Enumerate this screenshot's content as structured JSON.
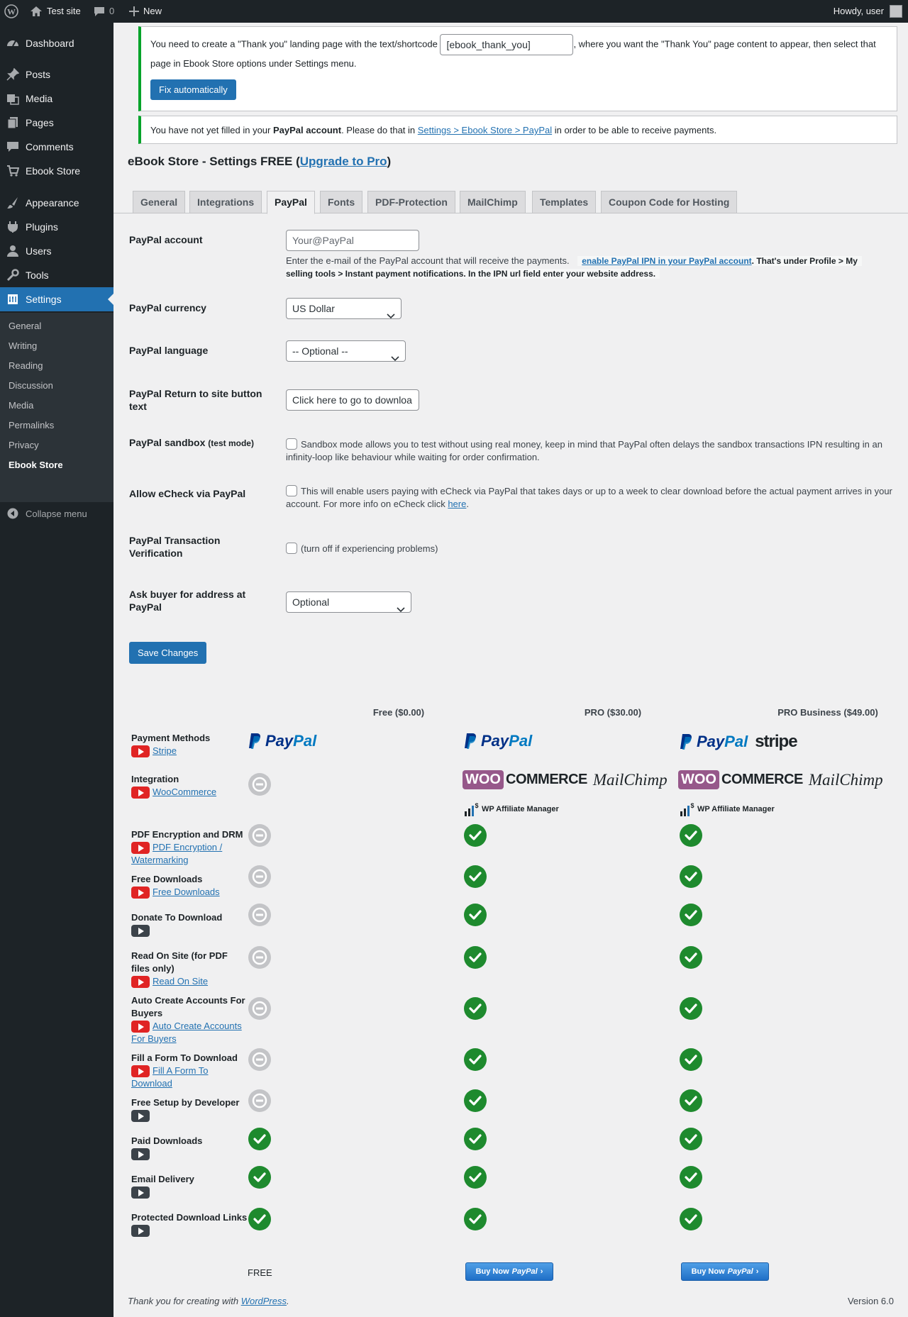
{
  "admin_bar": {
    "site_name": "Test site",
    "comments_count": "0",
    "new_label": "New",
    "howdy": "Howdy, user"
  },
  "sidebar": {
    "items": [
      {
        "label": "Dashboard",
        "icon": "dashboard-icon"
      },
      {
        "label": "Posts",
        "icon": "pin-icon"
      },
      {
        "label": "Media",
        "icon": "media-icon"
      },
      {
        "label": "Pages",
        "icon": "pages-icon"
      },
      {
        "label": "Comments",
        "icon": "comment-icon"
      },
      {
        "label": "Ebook Store",
        "icon": "cart-icon"
      },
      {
        "label": "Appearance",
        "icon": "brush-icon"
      },
      {
        "label": "Plugins",
        "icon": "plug-icon"
      },
      {
        "label": "Users",
        "icon": "user-icon"
      },
      {
        "label": "Tools",
        "icon": "wrench-icon"
      },
      {
        "label": "Settings",
        "icon": "settings-icon"
      }
    ],
    "submenu": [
      "General",
      "Writing",
      "Reading",
      "Discussion",
      "Media",
      "Permalinks",
      "Privacy",
      "Ebook Store"
    ],
    "collapse_label": "Collapse menu"
  },
  "notices": {
    "thank_you_pre": "You need to create a \"Thank you\" landing page with the text/shortcode",
    "thank_you_shortcode": "[ebook_thank_you]",
    "thank_you_post": ", where you want the \"Thank You\" page content to appear, then select that page in Ebook Store options under Settings menu.",
    "fix_button": "Fix automatically",
    "paypal_pre": "You have not yet filled in your ",
    "paypal_bold": "PayPal account",
    "paypal_mid": ". Please do that in ",
    "paypal_link": "Settings > Ebook Store > PayPal",
    "paypal_post": " in order to be able to receive payments."
  },
  "page": {
    "title_pre": "eBook Store - Settings FREE (",
    "title_link": "Upgrade to Pro",
    "title_post": ")"
  },
  "tabs": [
    "General",
    "Integrations",
    "PayPal",
    "Fonts",
    "PDF-Protection",
    "MailChimp",
    "Templates",
    "Coupon Code for Hosting"
  ],
  "form": {
    "paypal_account_label": "PayPal account",
    "paypal_account_placeholder": "Your@PayPal",
    "paypal_account_desc": "Enter the e-mail of the PayPal account that will receive the payments.",
    "ipn_link": "enable PayPal IPN in your PayPal account",
    "ipn_text_1": ". That's under Profile > My",
    "ipn_text_2": "selling tools > Instant payment notifications. In the IPN url field enter your website address.",
    "currency_label": "PayPal currency",
    "currency_value": "US Dollar",
    "language_label": "PayPal language",
    "language_value": "-- Optional --",
    "return_label": "PayPal Return to site button text",
    "return_value": "Click here to go to downloa",
    "sandbox_label": "PayPal sandbox",
    "sandbox_small": "(test mode)",
    "sandbox_desc": "Sandbox mode allows you to test without using real money, keep in mind that PayPal often delays the sandbox transactions IPN resulting in an infinity-loop like behaviour while waiting for order confirmation.",
    "echeck_label": "Allow eCheck via PayPal",
    "echeck_desc": "This will enable users paying with eCheck via PayPal that takes days or up to a week to clear download before the actual payment arrives in your account. For more info on eCheck click ",
    "echeck_link": "here",
    "verify_label": "PayPal Transaction Verification",
    "verify_desc": "(turn off if experiencing problems)",
    "address_label": "Ask buyer for address at PayPal",
    "address_value": "Optional",
    "save_button": "Save Changes"
  },
  "comparison": {
    "columns": [
      "Free ($0.00)",
      "PRO ($30.00)",
      "PRO Business ($49.00)"
    ],
    "features": [
      {
        "name": "Payment Methods",
        "link": "Stripe"
      },
      {
        "name": "Integration",
        "link": "WooCommerce"
      },
      {
        "name": "PDF Encryption and DRM",
        "link": "PDF Encryption / Watermarking"
      },
      {
        "name": "Free Downloads",
        "link": "Free Downloads"
      },
      {
        "name": "Donate To Download",
        "link": ""
      },
      {
        "name": "Read On Site (for PDF files only)",
        "link": "Read On Site"
      },
      {
        "name": "Auto Create Accounts For Buyers",
        "link": "Auto Create Accounts For Buyers"
      },
      {
        "name": "Fill a Form To Download",
        "link": "Fill A Form To Download"
      },
      {
        "name": "Free Setup by Developer",
        "link": ""
      },
      {
        "name": "Paid Downloads",
        "link": ""
      },
      {
        "name": "Email Delivery",
        "link": ""
      },
      {
        "name": "Protected Download Links",
        "link": ""
      }
    ],
    "logos": {
      "paypal_pay": "Pay",
      "paypal_pal": "Pal",
      "stripe": "stripe",
      "woo": "WOO",
      "commerce": "COMMERCE",
      "mailchimp": "MailChimp",
      "affiliate": "WP Affiliate Manager"
    },
    "free_label": "FREE",
    "buy_now": "Buy Now",
    "buy_now_brand": "PayPal"
  },
  "footer": {
    "thanks_pre": "Thank you for creating with ",
    "thanks_link": "WordPress",
    "thanks_post": ".",
    "version": "Version 6.0"
  }
}
